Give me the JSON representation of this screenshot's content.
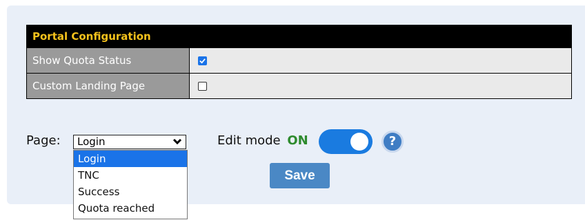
{
  "portal_configuration": {
    "title": "Portal Configuration",
    "rows": [
      {
        "label": "Show Quota Status",
        "checked": true
      },
      {
        "label": "Custom Landing Page",
        "checked": false
      }
    ]
  },
  "page_selector": {
    "label": "Page:",
    "selected": "Login",
    "options": [
      "Login",
      "TNC",
      "Success",
      "Quota reached"
    ]
  },
  "edit_mode": {
    "label": "Edit mode",
    "state": "ON"
  },
  "help_icon": "?",
  "save_label": "Save",
  "colors": {
    "header_text": "#f6c21c",
    "accent": "#1a73e8",
    "edit_on": "#2e8b2e",
    "save_button": "#4a88c5"
  }
}
